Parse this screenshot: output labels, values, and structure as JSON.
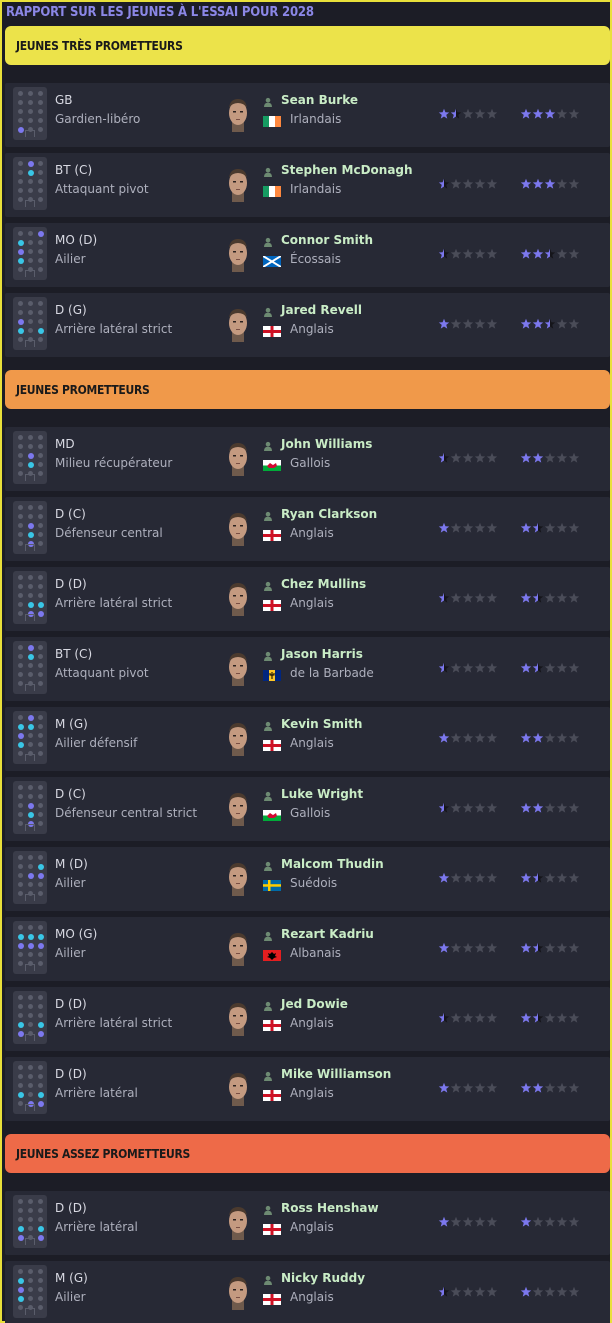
{
  "page_title": "RAPPORT SUR LES JEUNES À L'ESSAI POUR 2028",
  "colors": {
    "frame": "#e9e03a",
    "title": "#8b87e6",
    "section_tres": "#ece34a",
    "section_prom": "#f0994a",
    "section_assez": "#ee6a48",
    "player_name": "#c9ecc6",
    "star_on": "#7c78ee",
    "star_off": "#4a4c58",
    "star_half": "#15151a"
  },
  "sections": [
    {
      "title": "JEUNES TRÈS PROMETTEURS",
      "color": "#ece34a",
      "players": [
        {
          "position": "GB",
          "role": "Gardien-libéro",
          "name": "Sean Burke",
          "nationality": "Irlandais",
          "flag": "ireland",
          "current_stars": 1.5,
          "potential_stars": 3.0,
          "dots": [
            [
              0,
              4
            ]
          ]
        },
        {
          "position": "BT (C)",
          "role": "Attaquant pivot",
          "name": "Stephen McDonagh",
          "nationality": "Irlandais",
          "flag": "ireland",
          "current_stars": 0.5,
          "potential_stars": 3.0,
          "dots": [
            [
              1,
              0
            ],
            [
              1,
              1
            ]
          ]
        },
        {
          "position": "MO (D)",
          "role": "Ailier",
          "name": "Connor Smith",
          "nationality": "Écossais",
          "flag": "scotland",
          "current_stars": 0.5,
          "potential_stars": 2.5,
          "dots": [
            [
              0,
              1
            ],
            [
              2,
              0
            ],
            [
              0,
              2
            ],
            [
              0,
              3
            ]
          ]
        },
        {
          "position": "D (G)",
          "role": "Arrière latéral strict",
          "name": "Jared Revell",
          "nationality": "Anglais",
          "flag": "england",
          "current_stars": 1.0,
          "potential_stars": 2.5,
          "dots": [
            [
              0,
              2
            ],
            [
              0,
              3
            ],
            [
              2,
              3
            ]
          ]
        }
      ]
    },
    {
      "title": "JEUNES PROMETTEURS",
      "color": "#f0994a",
      "players": [
        {
          "position": "MD",
          "role": "Milieu récupérateur",
          "name": "John Williams",
          "nationality": "Gallois",
          "flag": "wales",
          "current_stars": 0.5,
          "potential_stars": 2.0,
          "dots": [
            [
              1,
              2
            ],
            [
              1,
              3
            ]
          ]
        },
        {
          "position": "D (C)",
          "role": "Défenseur central",
          "name": "Ryan Clarkson",
          "nationality": "Anglais",
          "flag": "england",
          "current_stars": 1.0,
          "potential_stars": 1.5,
          "dots": [
            [
              1,
              2
            ],
            [
              1,
              3
            ],
            [
              1,
              4
            ]
          ]
        },
        {
          "position": "D (D)",
          "role": "Arrière latéral strict",
          "name": "Chez Mullins",
          "nationality": "Anglais",
          "flag": "england",
          "current_stars": 0.5,
          "potential_stars": 1.5,
          "dots": [
            [
              1,
              3
            ],
            [
              2,
              3
            ],
            [
              1,
              4
            ],
            [
              2,
              4
            ]
          ]
        },
        {
          "position": "BT (C)",
          "role": "Attaquant pivot",
          "name": "Jason Harris",
          "nationality": "de la Barbade",
          "flag": "barbados",
          "current_stars": 0.5,
          "potential_stars": 1.5,
          "dots": [
            [
              1,
              0
            ],
            [
              1,
              1
            ]
          ]
        },
        {
          "position": "M (G)",
          "role": "Ailier défensif",
          "name": "Kevin Smith",
          "nationality": "Anglais",
          "flag": "england",
          "current_stars": 1.0,
          "potential_stars": 2.0,
          "dots": [
            [
              1,
              0
            ],
            [
              0,
              1
            ],
            [
              1,
              1
            ],
            [
              0,
              2
            ],
            [
              0,
              3
            ]
          ]
        },
        {
          "position": "D (C)",
          "role": "Défenseur central strict",
          "name": "Luke Wright",
          "nationality": "Gallois",
          "flag": "wales",
          "current_stars": 0.5,
          "potential_stars": 2.0,
          "dots": [
            [
              1,
              2
            ],
            [
              1,
              3
            ],
            [
              1,
              4
            ]
          ]
        },
        {
          "position": "M (D)",
          "role": "Ailier",
          "name": "Malcom Thudin",
          "nationality": "Suédois",
          "flag": "sweden",
          "current_stars": 1.0,
          "potential_stars": 1.5,
          "dots": [
            [
              2,
              1
            ],
            [
              2,
              2
            ],
            [
              1,
              2
            ]
          ]
        },
        {
          "position": "MO (G)",
          "role": "Ailier",
          "name": "Rezart Kadriu",
          "nationality": "Albanais",
          "flag": "albania",
          "current_stars": 1.0,
          "potential_stars": 1.5,
          "dots": [
            [
              0,
              1
            ],
            [
              1,
              1
            ],
            [
              2,
              1
            ],
            [
              0,
              2
            ],
            [
              1,
              2
            ],
            [
              2,
              2
            ]
          ]
        },
        {
          "position": "D (D)",
          "role": "Arrière latéral strict",
          "name": "Jed Dowie",
          "nationality": "Anglais",
          "flag": "england",
          "current_stars": 0.5,
          "potential_stars": 1.5,
          "dots": [
            [
              0,
              3
            ],
            [
              2,
              3
            ],
            [
              0,
              4
            ],
            [
              2,
              4
            ]
          ]
        },
        {
          "position": "D (D)",
          "role": "Arrière latéral",
          "name": "Mike Williamson",
          "nationality": "Anglais",
          "flag": "england",
          "current_stars": 1.0,
          "potential_stars": 2.0,
          "dots": [
            [
              0,
              3
            ],
            [
              2,
              3
            ],
            [
              1,
              4
            ],
            [
              2,
              4
            ]
          ]
        }
      ]
    },
    {
      "title": "JEUNES ASSEZ PROMETTEURS",
      "color": "#ee6a48",
      "players": [
        {
          "position": "D (D)",
          "role": "Arrière latéral",
          "name": "Ross Henshaw",
          "nationality": "Anglais",
          "flag": "england",
          "current_stars": 1.0,
          "potential_stars": 1.0,
          "dots": [
            [
              0,
              3
            ],
            [
              2,
              3
            ],
            [
              0,
              4
            ],
            [
              2,
              4
            ]
          ]
        },
        {
          "position": "M (G)",
          "role": "Ailier",
          "name": "Nicky Ruddy",
          "nationality": "Anglais",
          "flag": "england",
          "current_stars": 0.5,
          "potential_stars": 1.0,
          "dots": [
            [
              0,
              1
            ],
            [
              0,
              2
            ],
            [
              0,
              3
            ]
          ]
        }
      ]
    }
  ]
}
